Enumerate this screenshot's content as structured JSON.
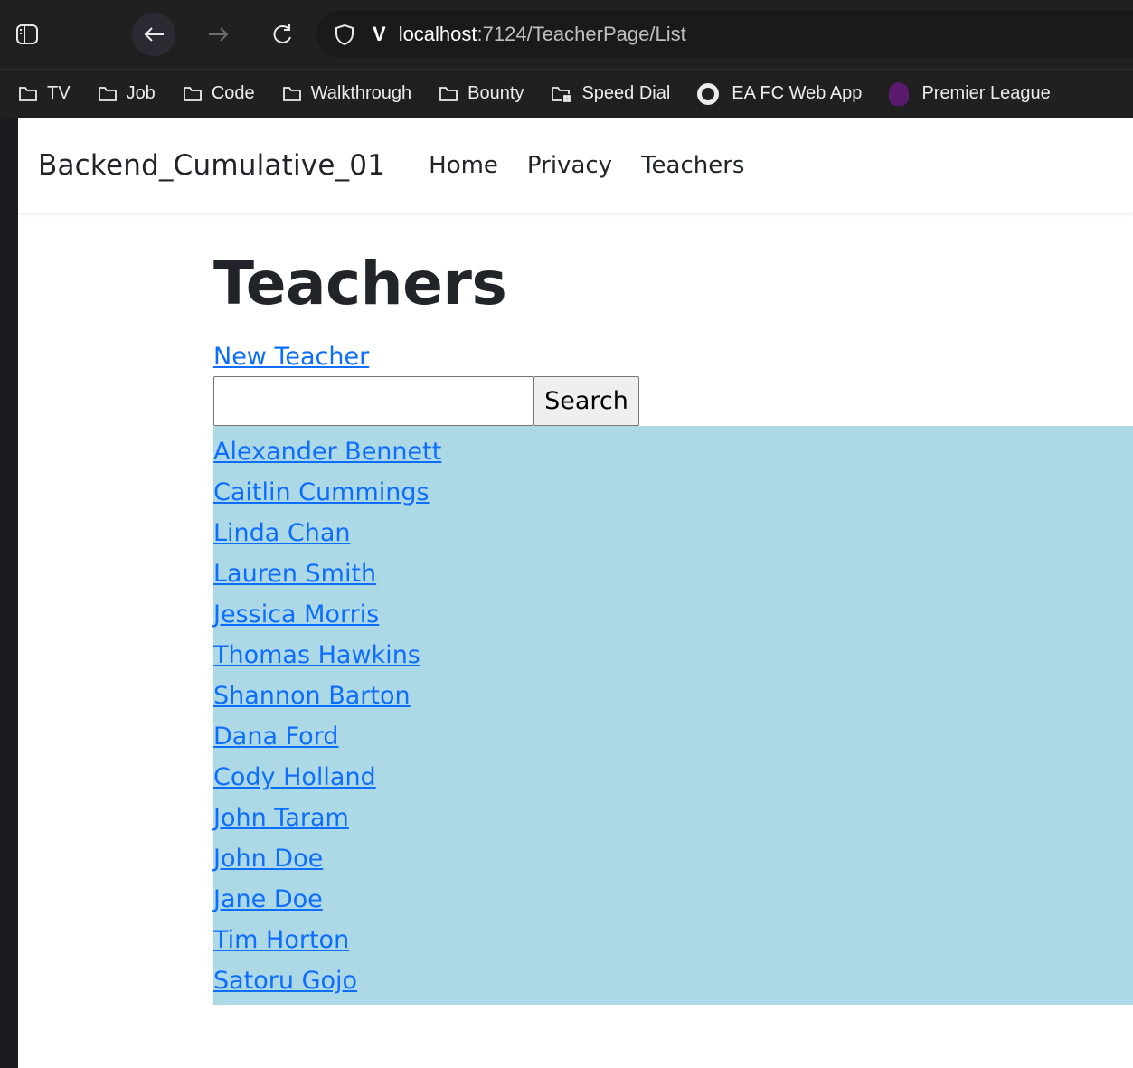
{
  "browser": {
    "url_host": "localhost",
    "url_rest": ":7124/TeacherPage/List",
    "bookmarks": [
      {
        "label": "TV",
        "icon": "folder-icon"
      },
      {
        "label": "Job",
        "icon": "folder-icon"
      },
      {
        "label": "Code",
        "icon": "folder-icon"
      },
      {
        "label": "Walkthrough",
        "icon": "folder-icon"
      },
      {
        "label": "Bounty",
        "icon": "folder-icon"
      },
      {
        "label": "Speed Dial",
        "icon": "speed-dial-icon"
      },
      {
        "label": "EA FC Web App",
        "icon": "globe-icon"
      },
      {
        "label": "Premier League",
        "icon": "premier-league-icon"
      }
    ]
  },
  "navbar": {
    "brand": "Backend_Cumulative_01",
    "links": [
      "Home",
      "Privacy",
      "Teachers"
    ]
  },
  "main": {
    "title": "Teachers",
    "new_link": "New Teacher",
    "search": {
      "value": "",
      "button_label": "Search"
    },
    "teachers": [
      "Alexander Bennett",
      "Caitlin Cummings",
      "Linda Chan",
      "Lauren Smith",
      "Jessica Morris",
      "Thomas Hawkins",
      "Shannon Barton",
      "Dana Ford",
      "Cody Holland",
      "John Taram",
      "John Doe",
      "Jane Doe",
      "Tim Horton",
      "Satoru Gojo"
    ]
  },
  "colors": {
    "link": "#0d6efd",
    "list_background": "#add8e6",
    "chrome_background": "#202020"
  }
}
